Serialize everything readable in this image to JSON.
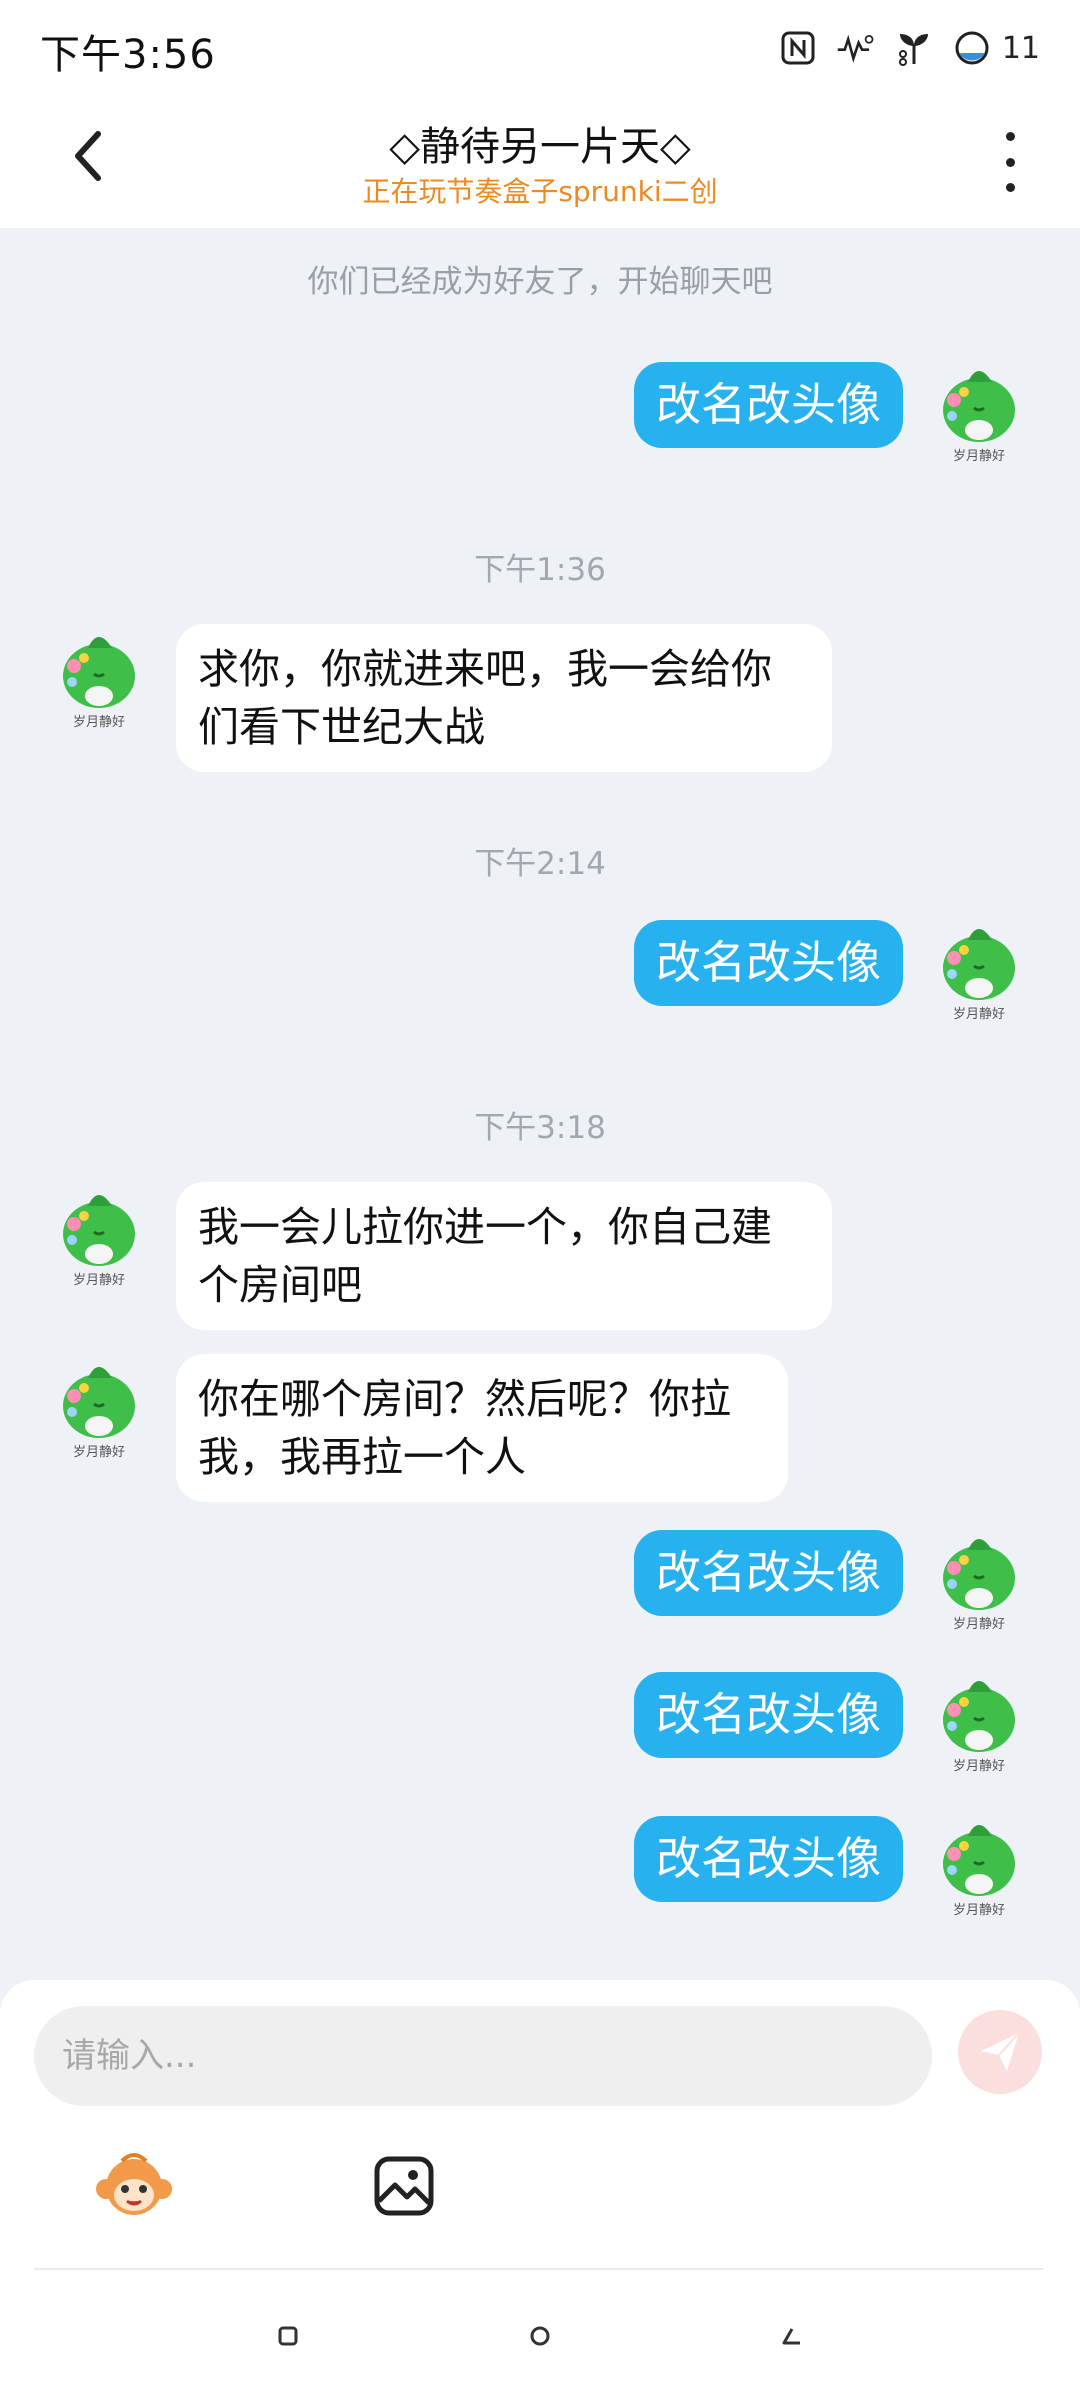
{
  "status_bar": {
    "time": "下午3:56",
    "battery": "11"
  },
  "header": {
    "title": "◇静待另一片天◇",
    "subtitle": "正在玩节奏盒子sprunki二创"
  },
  "chat": {
    "system_note": "你们已经成为好友了，开始聊天吧",
    "avatar_caption": "岁月静好",
    "timestamps": [
      "下午1:36",
      "下午2:14",
      "下午3:18"
    ],
    "messages": [
      {
        "side": "out",
        "text": "改名改头像"
      },
      {
        "side": "in",
        "lines": [
          "求你，你就进来吧，我一会给你",
          "们看下世纪大战"
        ]
      },
      {
        "side": "out",
        "text": "改名改头像"
      },
      {
        "side": "in",
        "lines": [
          "我一会儿拉你进一个，你自己建",
          "个房间吧"
        ]
      },
      {
        "side": "in",
        "lines": [
          "你在哪个房间？然后呢？你拉",
          "我，我再拉一个人"
        ]
      },
      {
        "side": "out",
        "text": "改名改头像"
      },
      {
        "side": "out",
        "text": "改名改头像"
      },
      {
        "side": "out",
        "text": "改名改头像"
      }
    ]
  },
  "composer": {
    "placeholder": "请输入..."
  },
  "icons": {
    "back": "chevron-left-icon",
    "more": "more-vertical-icon",
    "send": "send-icon",
    "emoji": "monkey-emoji-icon",
    "image": "image-icon",
    "nav_recent": "square-icon",
    "nav_home": "circle-icon",
    "nav_back": "triangle-icon"
  },
  "colors": {
    "outgoing_bubble": "#27b2ef",
    "incoming_bubble": "#ffffff",
    "subtitle": "#ee8a1f",
    "background": "#eef1f6",
    "send_button": "#fbdede"
  }
}
